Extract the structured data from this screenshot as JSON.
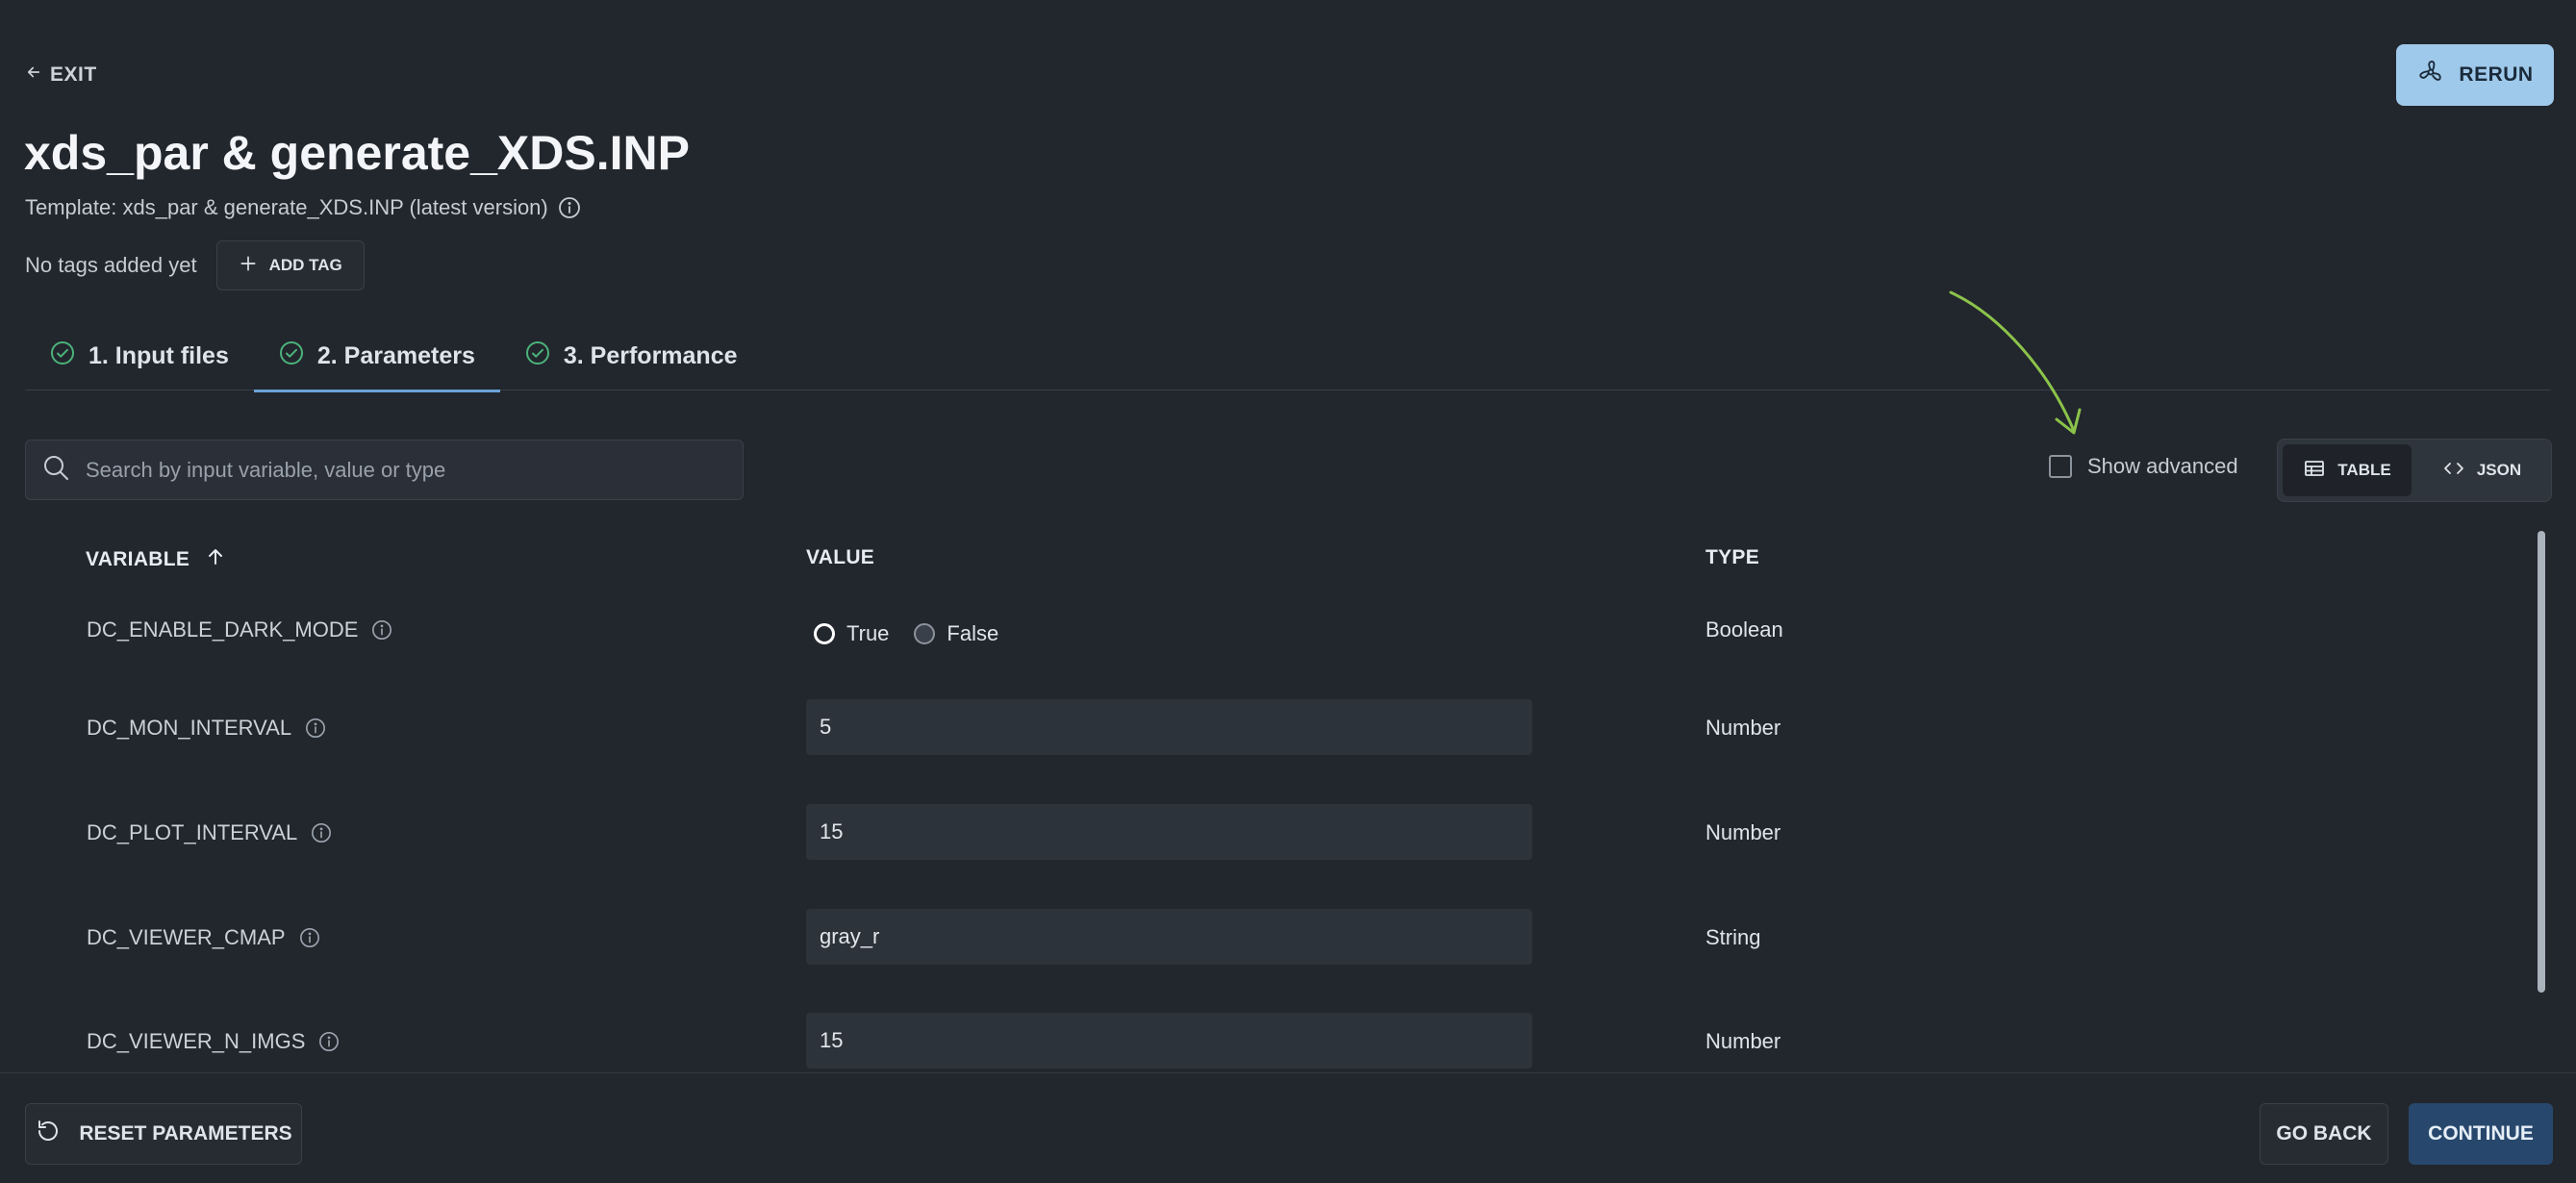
{
  "header": {
    "exit_label": "EXIT",
    "rerun_label": "RERUN",
    "title": "xds_par & generate_XDS.INP",
    "template_text": "Template: xds_par & generate_XDS.INP (latest version)",
    "no_tags_text": "No tags added yet",
    "add_tag_label": "ADD TAG"
  },
  "tabs": [
    {
      "label": "1. Input files",
      "icon": "check-circle-icon"
    },
    {
      "label": "2. Parameters",
      "icon": "check-circle-icon",
      "active": true
    },
    {
      "label": "3. Performance",
      "icon": "check-circle-icon"
    }
  ],
  "toolbar": {
    "search_placeholder": "Search by input variable, value or type",
    "search_value": "",
    "show_advanced_label": "Show advanced",
    "show_advanced_checked": false,
    "view_table_label": "TABLE",
    "view_json_label": "JSON",
    "active_view": "TABLE"
  },
  "table": {
    "columns": {
      "variable": "VARIABLE",
      "value": "VALUE",
      "type": "TYPE"
    },
    "sort": "ascending",
    "rows": [
      {
        "variable": "DC_ENABLE_DARK_MODE",
        "kind": "radio",
        "options": [
          "True",
          "False"
        ],
        "selected": "True",
        "type": "Boolean"
      },
      {
        "variable": "DC_MON_INTERVAL",
        "kind": "input",
        "value": "5",
        "type": "Number"
      },
      {
        "variable": "DC_PLOT_INTERVAL",
        "kind": "input",
        "value": "15",
        "type": "Number"
      },
      {
        "variable": "DC_VIEWER_CMAP",
        "kind": "input",
        "value": "gray_r",
        "type": "String"
      },
      {
        "variable": "DC_VIEWER_N_IMGS",
        "kind": "input",
        "value": "15",
        "type": "Number"
      }
    ]
  },
  "footer": {
    "reset_label": "RESET PARAMETERS",
    "go_back_label": "GO BACK",
    "continue_label": "CONTINUE"
  },
  "colors": {
    "background": "#22262d",
    "accent": "#9fc9ea",
    "success": "#4bb37a",
    "primary_button": "#27486c",
    "annotation_arrow": "#8bc34a"
  }
}
